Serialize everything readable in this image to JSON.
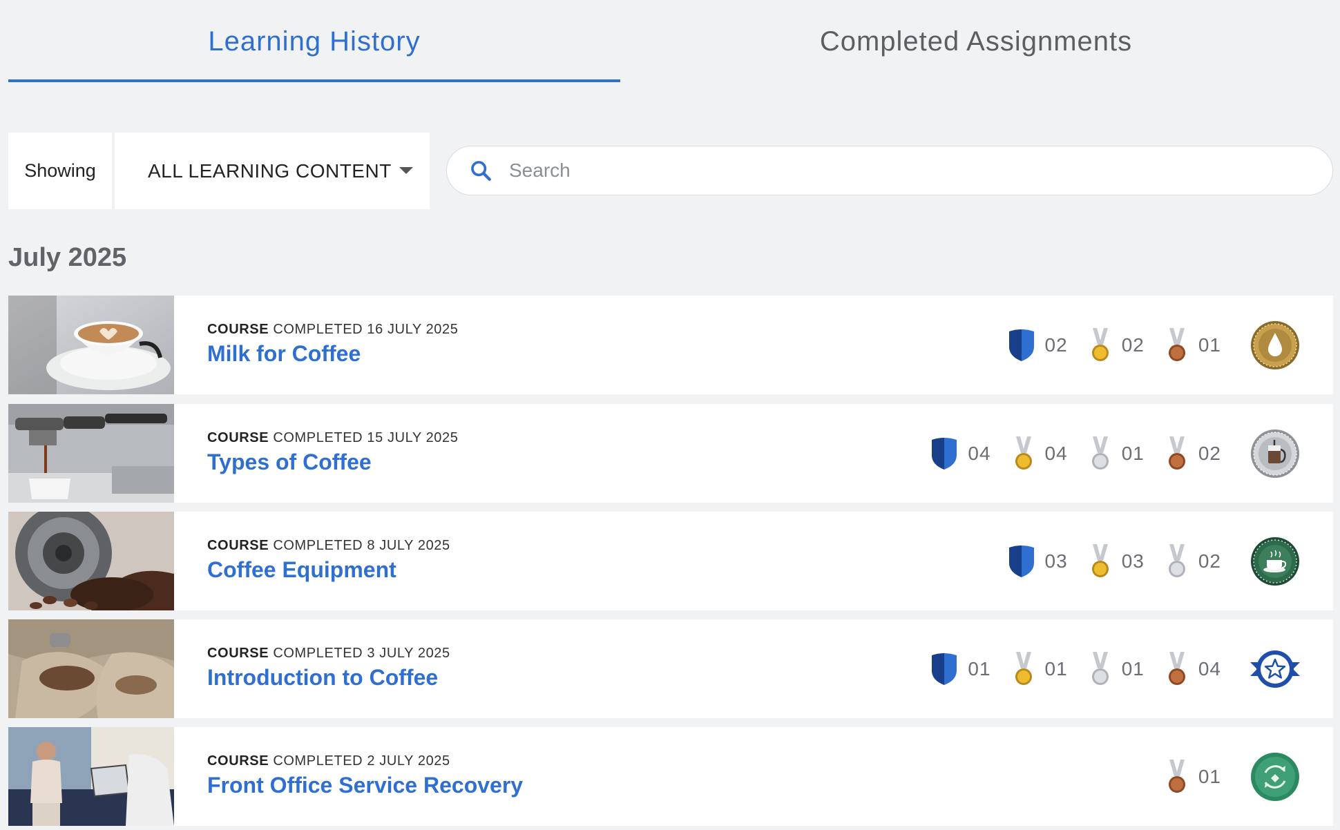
{
  "tabs": [
    {
      "label": "Learning History",
      "active": true
    },
    {
      "label": "Completed Assignments",
      "active": false
    }
  ],
  "filter": {
    "showing_label": "Showing",
    "selected": "ALL LEARNING CONTENT"
  },
  "search": {
    "placeholder": "Search"
  },
  "month": "July 2025",
  "colors": {
    "accent": "#2f6fd1",
    "shield": "#1f4fa8",
    "gold": "#e7b22a",
    "silver": "#c9ccd1",
    "bronze": "#b5653b"
  },
  "courses": [
    {
      "type": "COURSE",
      "status": "COMPLETED 16 JULY 2025",
      "title": "Milk for Coffee",
      "stats": [
        {
          "icon": "shield-icon",
          "count": "02"
        },
        {
          "icon": "gold-medal-icon",
          "count": "02"
        },
        {
          "icon": "bronze-medal-icon",
          "count": "01"
        }
      ],
      "badge": "milk-drop-badge-icon"
    },
    {
      "type": "COURSE",
      "status": "COMPLETED 15 JULY 2025",
      "title": "Types of Coffee",
      "stats": [
        {
          "icon": "shield-icon",
          "count": "04"
        },
        {
          "icon": "gold-medal-icon",
          "count": "04"
        },
        {
          "icon": "silver-medal-icon",
          "count": "01"
        },
        {
          "icon": "bronze-medal-icon",
          "count": "02"
        }
      ],
      "badge": "coffee-press-badge-icon"
    },
    {
      "type": "COURSE",
      "status": "COMPLETED 8 JULY 2025",
      "title": "Coffee Equipment",
      "stats": [
        {
          "icon": "shield-icon",
          "count": "03"
        },
        {
          "icon": "gold-medal-icon",
          "count": "03"
        },
        {
          "icon": "silver-medal-icon",
          "count": "02"
        }
      ],
      "badge": "coffee-cup-badge-icon"
    },
    {
      "type": "COURSE",
      "status": "COMPLETED 3 JULY 2025",
      "title": "Introduction to Coffee",
      "stats": [
        {
          "icon": "shield-icon",
          "count": "01"
        },
        {
          "icon": "gold-medal-icon",
          "count": "01"
        },
        {
          "icon": "silver-medal-icon",
          "count": "01"
        },
        {
          "icon": "bronze-medal-icon",
          "count": "04"
        }
      ],
      "badge": "star-badge-icon"
    },
    {
      "type": "COURSE",
      "status": "COMPLETED 2 JULY 2025",
      "title": "Front Office Service Recovery",
      "stats": [
        {
          "icon": "bronze-medal-icon",
          "count": "01"
        }
      ],
      "badge": "service-recovery-badge-icon"
    }
  ]
}
